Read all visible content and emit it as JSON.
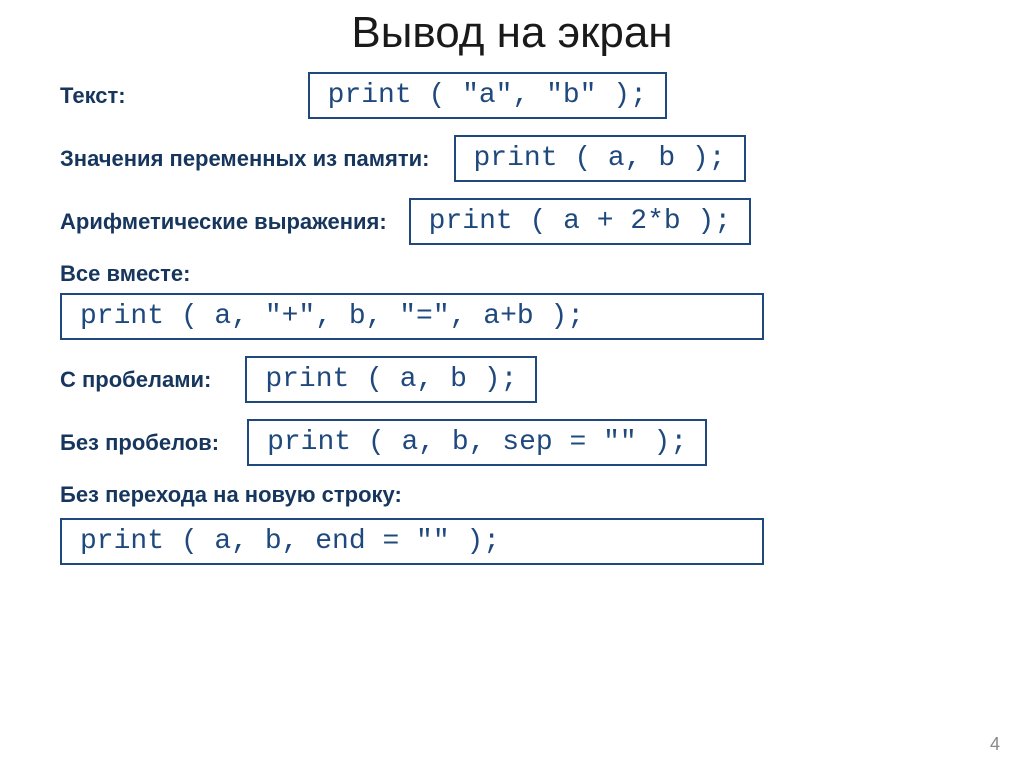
{
  "title": "Вывод на экран",
  "rows": {
    "text": {
      "label": "Текст:",
      "code": "print ( \"a\", \"b\" );"
    },
    "variables": {
      "label": "Значения переменных из памяти:",
      "code": "print ( a, b );"
    },
    "arithmetic": {
      "label": "Арифметические выражения:",
      "code": "print ( a + 2*b );"
    },
    "all_together": {
      "label": "Все вместе:",
      "code": "print ( a, \"+\", b, \"=\",  a+b );"
    },
    "with_spaces": {
      "label": "С пробелами:",
      "code": "print ( a, b );"
    },
    "without_spaces": {
      "label": "Без пробелов:",
      "code": "print ( a, b, sep = \"\" );"
    },
    "no_newline": {
      "label": "Без перехода на новую строку:",
      "code": "print ( a, b, end = \"\" );"
    }
  },
  "page_number": "4"
}
